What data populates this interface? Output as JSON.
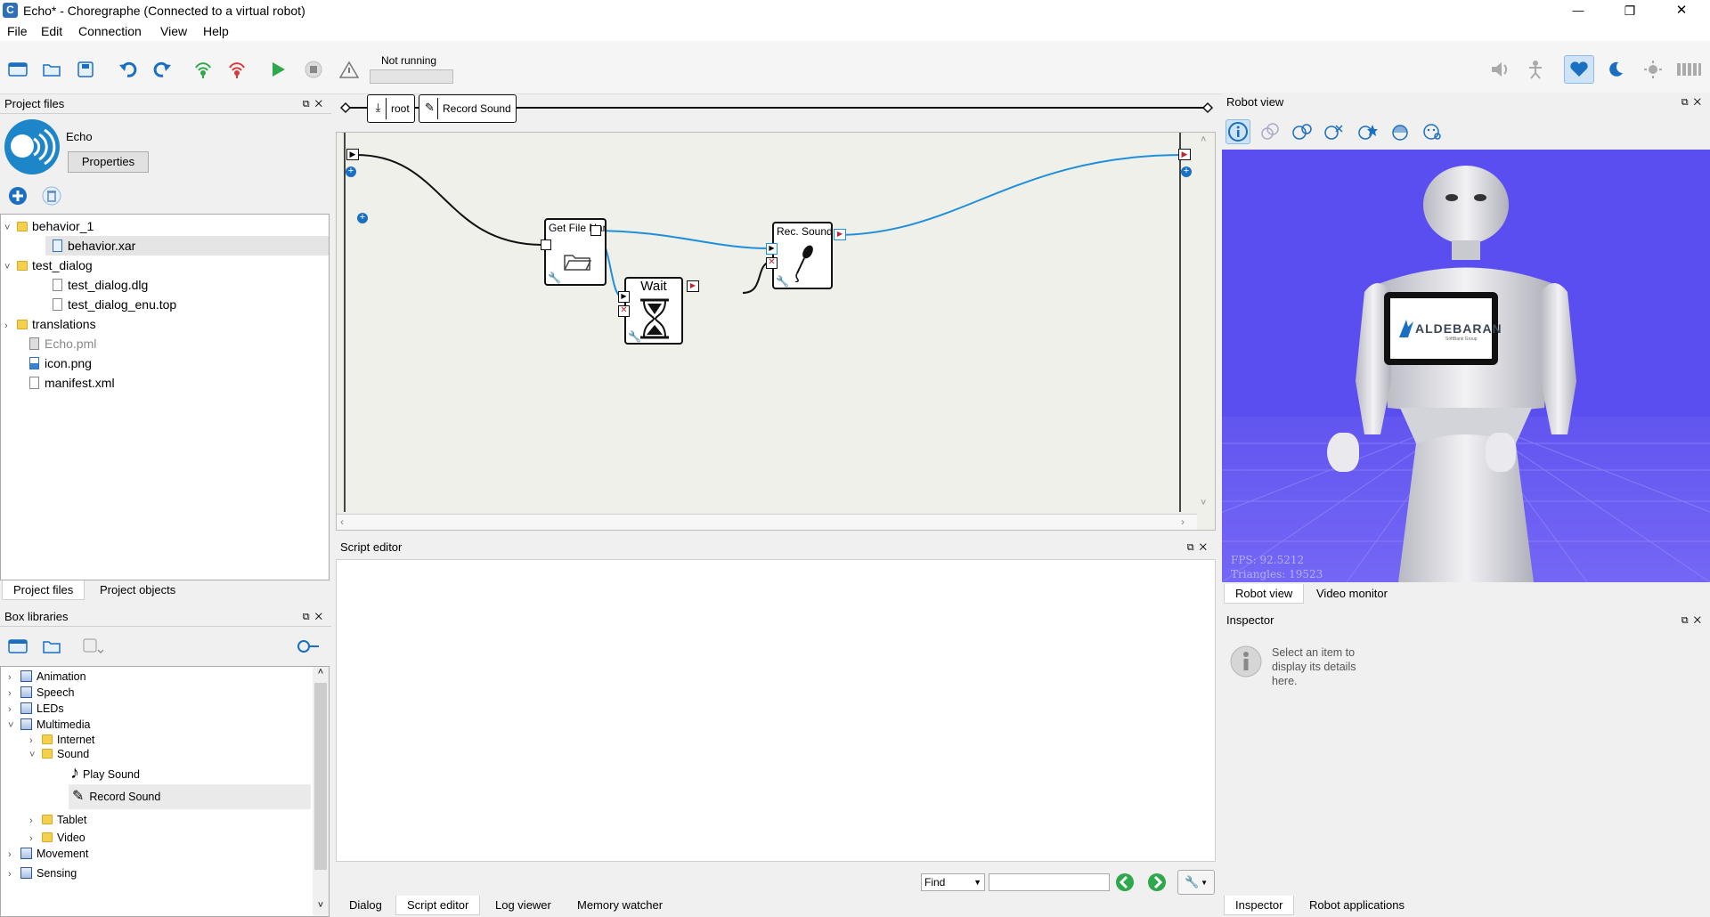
{
  "window": {
    "title": "Echo* - Choregraphe (Connected to a virtual robot)",
    "app_icon_letter": "C",
    "controls": [
      "—",
      "❐",
      "✕"
    ]
  },
  "menu": [
    "File",
    "Edit",
    "Connection",
    "View",
    "Help"
  ],
  "toolbar": {
    "status": "Not running"
  },
  "project_files": {
    "title": "Project files",
    "project_name": "Echo",
    "properties_label": "Properties",
    "tree": [
      {
        "label": "behavior_1",
        "type": "folder",
        "expanded": true
      },
      {
        "label": "behavior.xar",
        "type": "xar",
        "selected": true
      },
      {
        "label": "test_dialog",
        "type": "folder",
        "expanded": true
      },
      {
        "label": "test_dialog.dlg",
        "type": "file"
      },
      {
        "label": "test_dialog_enu.top",
        "type": "file"
      },
      {
        "label": "translations",
        "type": "folder",
        "expanded": false
      },
      {
        "label": "Echo.pml",
        "type": "pml"
      },
      {
        "label": "icon.png",
        "type": "png"
      },
      {
        "label": "manifest.xml",
        "type": "file"
      }
    ],
    "tabs": [
      "Project files",
      "Project objects"
    ]
  },
  "box_libraries": {
    "title": "Box libraries",
    "items": [
      {
        "label": "Animation",
        "type": "lib"
      },
      {
        "label": "Speech",
        "type": "lib"
      },
      {
        "label": "LEDs",
        "type": "lib"
      },
      {
        "label": "Multimedia",
        "type": "lib"
      },
      {
        "label": "Internet",
        "type": "folder"
      },
      {
        "label": "Sound",
        "type": "folder"
      },
      {
        "label": "Play Sound",
        "type": "box"
      },
      {
        "label": "Record Sound",
        "type": "box"
      },
      {
        "label": "Tablet",
        "type": "folder"
      },
      {
        "label": "Video",
        "type": "folder"
      },
      {
        "label": "Movement",
        "type": "lib"
      },
      {
        "label": "Sensing",
        "type": "lib"
      }
    ]
  },
  "flow": {
    "breadcrumb": [
      "root",
      "Record Sound"
    ],
    "boxes": {
      "get_file_name": "Get File Name",
      "wait": "Wait",
      "rec_sound": "Rec. Sound F"
    }
  },
  "script_editor": {
    "title": "Script editor",
    "find_label": "Find",
    "tabs": [
      "Dialog",
      "Script editor",
      "Log viewer",
      "Memory watcher"
    ]
  },
  "robot_view": {
    "title": "Robot view",
    "fps": "FPS: 92.5212",
    "triangles": "Triangles: 19523",
    "tablet_brand": "ALDEBARAN",
    "tablet_sub": "SoftBank Group",
    "tabs": [
      "Robot view",
      "Video monitor"
    ]
  },
  "inspector": {
    "title": "Inspector",
    "message_line1": "Select an item to",
    "message_line2": "display its details",
    "message_line3": "here.",
    "tabs": [
      "Inspector",
      "Robot applications"
    ]
  },
  "colors": {
    "accent": "#1a8ad4",
    "robot_bg": "#5a4ef0",
    "wire": "#1e8fd8"
  }
}
